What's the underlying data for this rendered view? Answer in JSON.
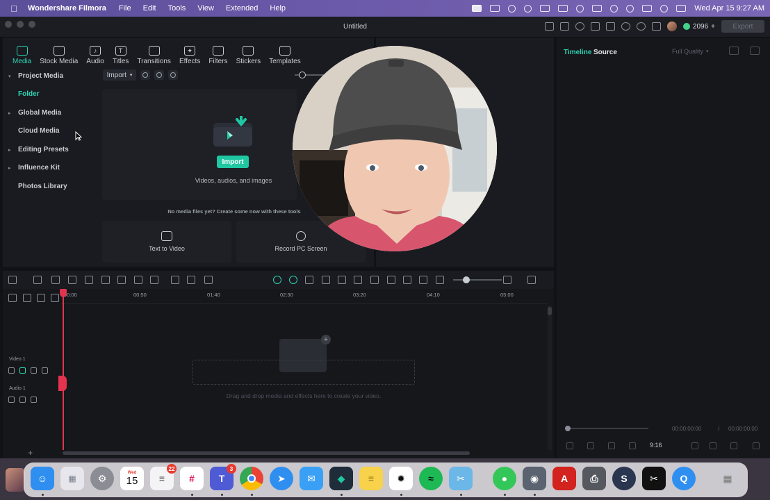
{
  "menubar": {
    "app_name": "Wondershare Filmora",
    "menus": [
      "File",
      "Edit",
      "Tools",
      "View",
      "Extended",
      "Help"
    ],
    "datetime": "Wed Apr 15  9:27 AM"
  },
  "window": {
    "title": "Untitled",
    "credits": "2096",
    "export_label": "Export"
  },
  "media_tabs": [
    {
      "label": "Media",
      "icon": "media-icon",
      "active": true
    },
    {
      "label": "Stock Media",
      "icon": "stock-media-icon"
    },
    {
      "label": "Audio",
      "icon": "music-note-icon"
    },
    {
      "label": "Titles",
      "icon": "text-t-icon"
    },
    {
      "label": "Transitions",
      "icon": "transitions-icon"
    },
    {
      "label": "Effects",
      "icon": "sparkle-icon"
    },
    {
      "label": "Filters",
      "icon": "filters-icon"
    },
    {
      "label": "Stickers",
      "icon": "sticker-icon"
    },
    {
      "label": "Templates",
      "icon": "templates-icon"
    }
  ],
  "sidebar": {
    "items": [
      {
        "label": "Project Media",
        "caret": "▾",
        "bold": true
      },
      {
        "label": "Folder",
        "selected": true
      },
      {
        "label": "Global Media",
        "caret": "▸"
      },
      {
        "label": "Cloud Media",
        "caret": ""
      },
      {
        "label": "Editing Presets",
        "caret": "▸"
      },
      {
        "label": "Influence Kit",
        "caret": "▸"
      },
      {
        "label": "Photos Library",
        "caret": ""
      }
    ]
  },
  "import": {
    "dropdown_label": "Import",
    "button_label": "Import",
    "caption": "Videos, audios, and images",
    "no_media_text": "No media files yet? Create some now with these tools"
  },
  "tools": [
    {
      "label": "Text to Video",
      "icon": "text-to-video-icon"
    },
    {
      "label": "Record PC Screen",
      "icon": "record-icon"
    }
  ],
  "right_panel": {
    "tab_timeline": "Timeline",
    "tab_source": "Source",
    "quality": "Full Quality",
    "time_current": "00:00:00:00",
    "time_separator": "/",
    "time_total": "00:00:00:00",
    "aspect_ratio": "9:16"
  },
  "timeline": {
    "ruler": [
      "00:00",
      "00:50",
      "01:40",
      "02:30",
      "03:20",
      "04:10",
      "05:00"
    ],
    "tracks": [
      {
        "label": "Video 1"
      },
      {
        "label": "Audio 1"
      }
    ],
    "drop_hint": "Drag and drop media and effects here to create your video.",
    "add_track": "+"
  },
  "dock": {
    "calendar_month": "Wed",
    "calendar_day": "15",
    "reminders_badge": "22",
    "teams_badge": "3",
    "apps": [
      {
        "name": "finder-icon",
        "color": "#2f8ff0"
      },
      {
        "name": "launchpad-icon",
        "color": "#e6e6ec"
      },
      {
        "name": "system-settings-icon",
        "color": "#8a8d94"
      },
      {
        "name": "calendar-icon",
        "color": "#ffffff"
      },
      {
        "name": "reminders-icon",
        "color": "#f4f4f6"
      },
      {
        "name": "slack-icon",
        "color": "#ffffff"
      },
      {
        "name": "teams-icon",
        "color": "#4f5bd5"
      },
      {
        "name": "chrome-icon",
        "color": "#ffffff"
      },
      {
        "name": "safari-icon",
        "color": "#2f8ff0"
      },
      {
        "name": "mail-icon",
        "color": "#3aa0f5"
      },
      {
        "name": "filmora-icon",
        "color": "#1f2d3a"
      },
      {
        "name": "notes-icon",
        "color": "#f7d24a"
      },
      {
        "name": "chatgpt-icon",
        "color": "#ffffff"
      },
      {
        "name": "spotify-icon",
        "color": "#1db954"
      },
      {
        "name": "scissors-icon",
        "color": "#6ab7e8"
      },
      {
        "name": "messages-icon",
        "color": "#33c759"
      },
      {
        "name": "screenshot-icon",
        "color": "#5b6270"
      },
      {
        "name": "acrobat-icon",
        "color": "#d2231f"
      },
      {
        "name": "printer-icon",
        "color": "#55585e"
      },
      {
        "name": "s-app-icon",
        "color": "#2a3550"
      },
      {
        "name": "capcut-icon",
        "color": "#111111"
      },
      {
        "name": "quicktime-icon",
        "color": "#2f8ff0"
      },
      {
        "name": "trash-icon",
        "color": "#c9c9cf"
      }
    ]
  }
}
